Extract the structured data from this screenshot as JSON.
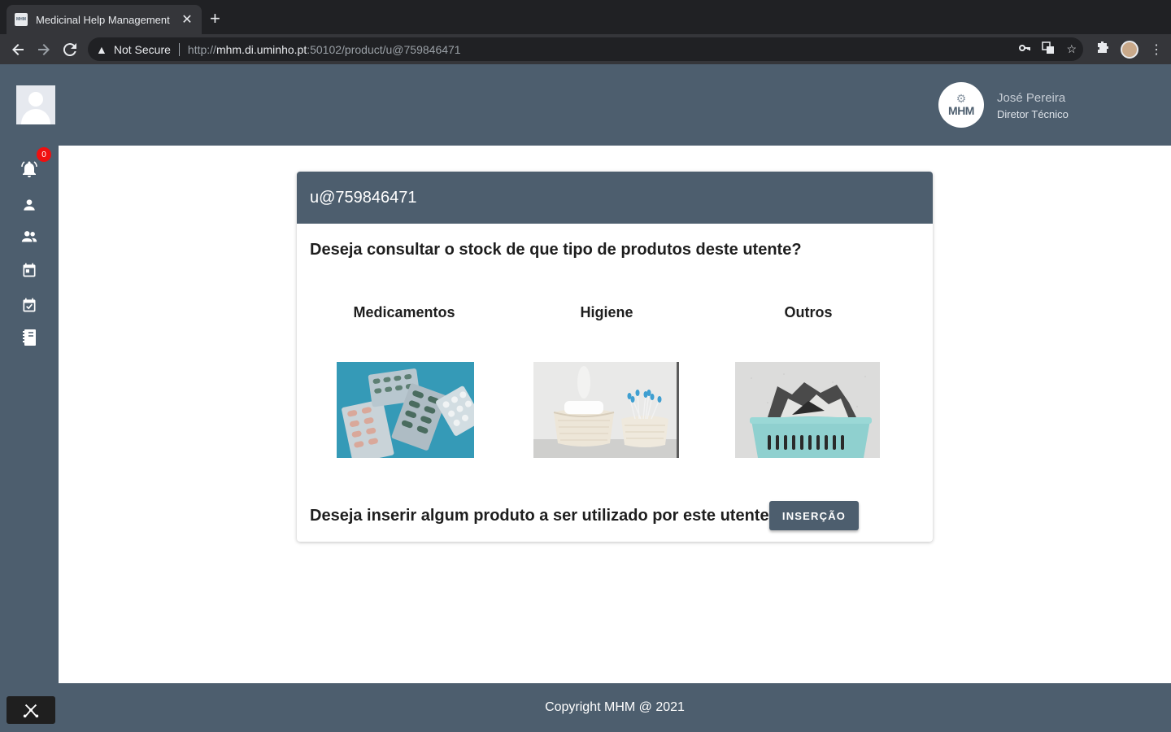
{
  "browser": {
    "tab_title": "Medicinal Help Management",
    "tab_close": "✕",
    "new_tab": "+",
    "security_label": "Not Secure",
    "url_scheme": "http://",
    "url_host": "mhm.di.uminho.pt",
    "url_path": ":50102/product/u@759846471"
  },
  "header": {
    "logo_text": "MHM",
    "user_name": "José Pereira",
    "user_role": "Diretor Técnico"
  },
  "sidebar": {
    "notification_count": "0",
    "items": [
      "bell-icon",
      "person-icon",
      "people-icon",
      "calendar-icon",
      "event-check-icon",
      "notebook-icon"
    ]
  },
  "card": {
    "title": "u@759846471",
    "question": "Deseja consultar o stock de que tipo de produtos deste utente?",
    "categories": [
      {
        "label": "Medicamentos"
      },
      {
        "label": "Higiene"
      },
      {
        "label": "Outros"
      }
    ],
    "insert_question": "Deseja inserir algum produto a ser utilizado por este utente?",
    "insert_button": "INSERÇÃO"
  },
  "footer": {
    "copyright": "Copyright MHM @ 2021"
  },
  "colors": {
    "primary": "#4d5e6e",
    "badge": "#f01010"
  }
}
